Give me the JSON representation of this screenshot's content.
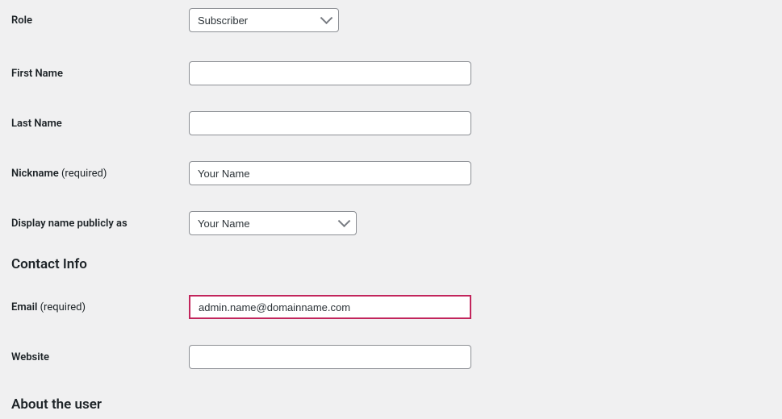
{
  "fields": {
    "role": {
      "label": "Role",
      "value": "Subscriber"
    },
    "first_name": {
      "label": "First Name",
      "value": ""
    },
    "last_name": {
      "label": "Last Name",
      "value": ""
    },
    "nickname": {
      "label": "Nickname",
      "required_text": "(required)",
      "value": "Your Name"
    },
    "display_name": {
      "label": "Display name publicly as",
      "value": "Your Name"
    },
    "email": {
      "label": "Email",
      "required_text": "(required)",
      "value": "admin.name@domainname.com"
    },
    "website": {
      "label": "Website",
      "value": ""
    }
  },
  "headings": {
    "contact_info": "Contact Info",
    "about_user": "About the user"
  }
}
